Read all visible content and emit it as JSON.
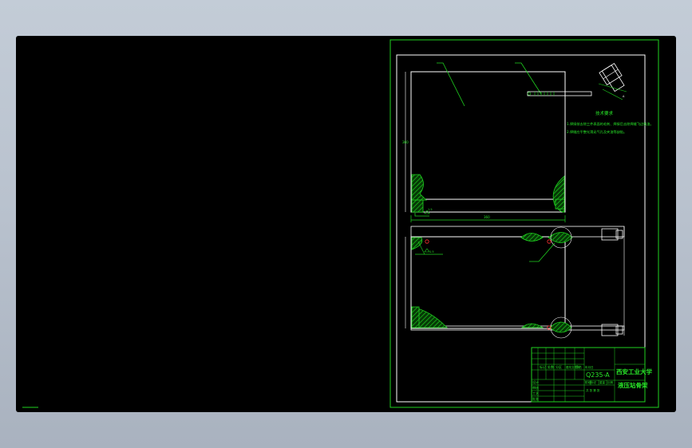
{
  "drawing": {
    "tech_requirements_title": "技术要求",
    "tech_notes": [
      "1.焊接前去除工件表面的毛刺、焊接后去除焊缝飞边残渣。",
      "2.焊缝应平整光滑无气孔及夹渣等缺陷。"
    ],
    "dimensions": {
      "top_view_width": "360",
      "top_view_height": "360"
    }
  },
  "title_block": {
    "material": "Q235-A",
    "organization": "西安工业大学",
    "drawing_name": "液压站骨架",
    "header_cells": [
      "标记",
      "处数",
      "分区",
      "更改文件号",
      "签名",
      "年月日"
    ],
    "role_cells": [
      "设计",
      "审核",
      "工艺",
      "批准"
    ],
    "scale_label": "比例",
    "weight_label": "重量",
    "stage_label": "阶段标记",
    "sheet_label": "共 张 第 张"
  },
  "colors": {
    "background": "#000000",
    "frame": "#1fd21f",
    "outline": "#ffffff"
  }
}
